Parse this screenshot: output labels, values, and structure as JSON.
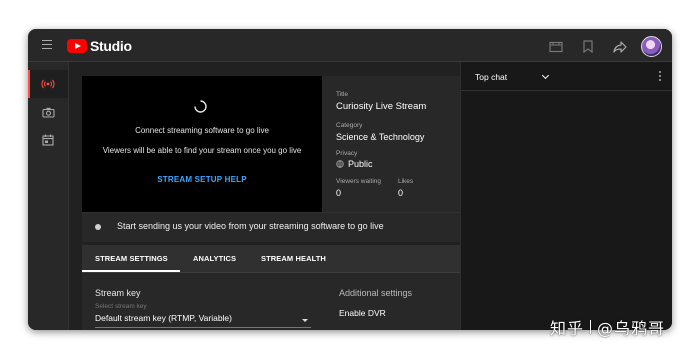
{
  "header": {
    "logo_text": "Studio"
  },
  "rail": {
    "items": [
      "live-icon",
      "camera-icon",
      "calendar-icon"
    ]
  },
  "preview": {
    "line1": "Connect streaming software to go live",
    "line2": "Viewers will be able to find your stream once you go live",
    "help_link": "STREAM SETUP HELP"
  },
  "info": {
    "title_label": "Title",
    "title_value": "Curiosity Live Stream",
    "category_label": "Category",
    "category_value": "Science & Technology",
    "privacy_label": "Privacy",
    "privacy_value": "Public",
    "viewers_label": "Viewers waiting",
    "viewers_value": "0",
    "likes_label": "Likes",
    "likes_value": "0"
  },
  "status": {
    "text": "Start sending us your video from your streaming software to go live"
  },
  "tabs": [
    {
      "label": "STREAM SETTINGS",
      "active": true
    },
    {
      "label": "ANALYTICS",
      "active": false
    },
    {
      "label": "STREAM HEALTH",
      "active": false
    }
  ],
  "settings": {
    "stream_key_label": "Stream key",
    "select_placeholder": "Select stream key",
    "select_value": "Default stream key (RTMP, Variable)",
    "additional_label": "Additional settings",
    "dvr_label": "Enable DVR"
  },
  "chat": {
    "title": "Top chat"
  },
  "watermark": {
    "left": "知乎",
    "right": "@乌鸦哥"
  },
  "colors": {
    "accent_red": "#ff0000",
    "link_blue": "#3ea6ff",
    "background": "#212121"
  }
}
